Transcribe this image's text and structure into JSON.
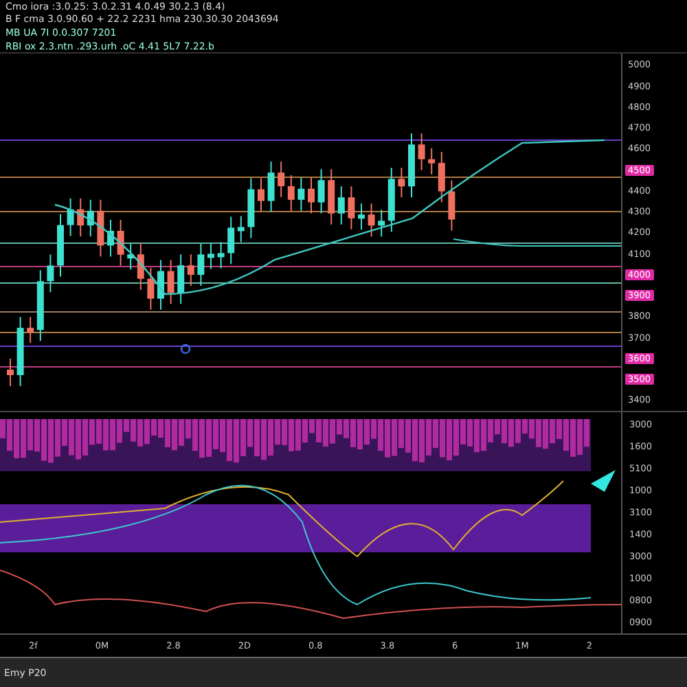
{
  "header": {
    "lines": [
      "Cmo iora :3.0.25: 3.0.2.31 4.0.49 30.2.3 (8.4)",
      "B F cma 3.0.90.60 + 22.2 2231 hma 230.30.30 2043694"
    ]
  },
  "legend": {
    "lines": [
      "MB UA 7I 0.0.307 7201",
      "RBI ox 2.3.ntn .293.urh .oC 4.41 5L7 7.22.b"
    ]
  },
  "price_axis": [
    {
      "text": "5000",
      "kind": "tick"
    },
    {
      "text": "4900",
      "kind": "tick"
    },
    {
      "text": "4800",
      "kind": "tick"
    },
    {
      "text": "4700",
      "kind": "tick"
    },
    {
      "text": "4600",
      "kind": "tick"
    },
    {
      "text": "4500",
      "kind": "badge"
    },
    {
      "text": "4400",
      "kind": "tick"
    },
    {
      "text": "4300",
      "kind": "tick"
    },
    {
      "text": "4200",
      "kind": "tick"
    },
    {
      "text": "4100",
      "kind": "tick"
    },
    {
      "text": "4000",
      "kind": "badge"
    },
    {
      "text": "3900",
      "kind": "badge"
    },
    {
      "text": "3800",
      "kind": "tick"
    },
    {
      "text": "3700",
      "kind": "tick"
    },
    {
      "text": "3600",
      "kind": "badge"
    },
    {
      "text": "3500",
      "kind": "badge"
    },
    {
      "text": "3400",
      "kind": "tick"
    }
  ],
  "indicator_axis": [
    "3000",
    "1600",
    "5100",
    "1000",
    "3100",
    "1400",
    "3000",
    "1000",
    "0800",
    "0900"
  ],
  "time_axis": [
    "2f",
    "0M",
    "2.8",
    "2D",
    "0.8",
    "3.8",
    "6",
    "1M",
    "2"
  ],
  "footer": {
    "text": "Emy P20"
  }
}
